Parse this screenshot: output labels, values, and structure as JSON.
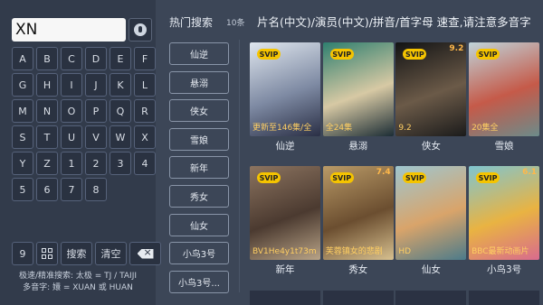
{
  "search": {
    "value": "XN"
  },
  "keyboard": {
    "letters": [
      "A",
      "B",
      "C",
      "D",
      "E",
      "F",
      "G",
      "H",
      "I",
      "J",
      "K",
      "L",
      "M",
      "N",
      "O",
      "P",
      "Q",
      "R",
      "S",
      "T",
      "U",
      "V",
      "W",
      "X",
      "Y",
      "Z",
      "1",
      "2",
      "3",
      "4",
      "5",
      "6",
      "7",
      "8"
    ],
    "bottom": {
      "nine": "9",
      "search_label": "搜索",
      "clear_label": "清空"
    }
  },
  "hints": {
    "line1": "极速/精准搜索: 太极 = TJ / TAIJI",
    "line2": "多音字: 嬛 = XUAN 或 HUAN"
  },
  "hot": {
    "title": "热门搜索",
    "count": "10条",
    "items": [
      "仙逆",
      "悬溺",
      "侠女",
      "雪娘",
      "新年",
      "秀女",
      "仙女",
      "小鸟3号",
      "小鸟3号..."
    ]
  },
  "tip": "片名(中文)/演员(中文)/拼音/首字母 速查,请注意多音字",
  "results": [
    {
      "title": "仙逆",
      "badge": "SVIP",
      "rating": "",
      "episode": "更新至146集/全",
      "colors": [
        "#dfe6ee",
        "#7e8aa3",
        "#2a2f45"
      ]
    },
    {
      "title": "悬溺",
      "badge": "SVIP",
      "rating": "",
      "episode": "全24集",
      "colors": [
        "#2f7f6f",
        "#d7c9a4",
        "#1c2d35"
      ]
    },
    {
      "title": "侠女",
      "badge": "SVIP",
      "rating": "9.2",
      "episode": "9.2",
      "colors": [
        "#121314",
        "#6b5a48",
        "#1b1b1b"
      ]
    },
    {
      "title": "雪娘",
      "badge": "SVIP",
      "rating": "",
      "episode": "20集全",
      "colors": [
        "#bfd4da",
        "#c55a49",
        "#6c8b8a"
      ]
    },
    {
      "title": "新年",
      "badge": "SVIP",
      "rating": "",
      "episode": "BV1He4y1t73m",
      "colors": [
        "#8c7460",
        "#4b3a30",
        "#b8a387"
      ]
    },
    {
      "title": "秀女",
      "badge": "SVIP",
      "rating": "7.4",
      "episode": "芙蓉镇女的悲剧",
      "colors": [
        "#b99a67",
        "#6b4e30",
        "#d7c08f"
      ]
    },
    {
      "title": "仙女",
      "badge": "SVIP",
      "rating": "",
      "episode": "HD",
      "colors": [
        "#9ec6cf",
        "#d9a46a",
        "#4c7b8a"
      ]
    },
    {
      "title": "小鸟3号",
      "badge": "SVIP",
      "rating": "6.1",
      "episode": "BBC最新动画片",
      "colors": [
        "#7fc5d0",
        "#e9b342",
        "#d86b8e"
      ]
    }
  ]
}
